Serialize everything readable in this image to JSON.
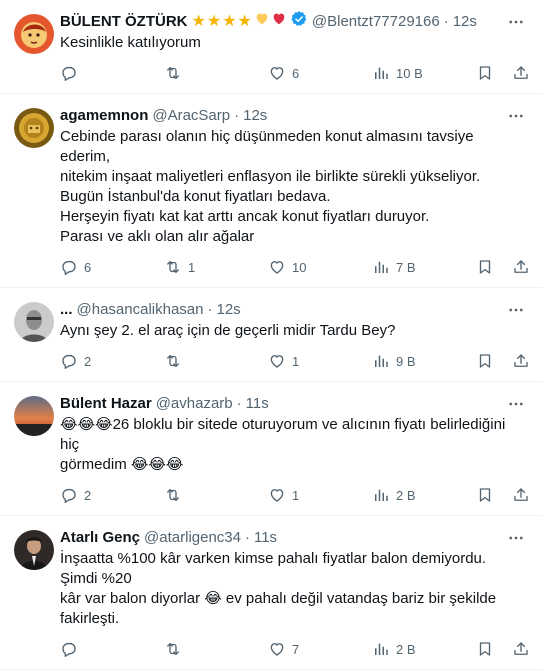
{
  "tweets": [
    {
      "name": "BÜLENT ÖZTÜRK",
      "name_emojis": "★★★★",
      "handle": "@Blentzt77729166",
      "time": "12s",
      "lines": [
        "Kesinlikle katılıyorum"
      ],
      "replies": "",
      "retweets": "",
      "likes": "6",
      "views": "10 B",
      "verified": true
    },
    {
      "name": "agamemnon",
      "handle": "@AracSarp",
      "time": "12s",
      "lines": [
        "Cebinde parası olanın hiç düşünmeden konut almasını tavsiye ederim,",
        "nitekim inşaat maliyetleri enflasyon ile birlikte sürekli yükseliyor.",
        "Bugün İstanbul'da konut fiyatları bedava.",
        "Herşeyin fiyatı kat kat arttı ancak konut fiyatları duruyor.",
        "Parası ve aklı olan alır ağalar"
      ],
      "replies": "6",
      "retweets": "1",
      "likes": "10",
      "views": "7 B"
    },
    {
      "name": "...",
      "handle": "@hasancalikhasan",
      "time": "12s",
      "lines": [
        "Aynı şey 2. el araç için de geçerli midir Tardu Bey?"
      ],
      "replies": "2",
      "retweets": "",
      "likes": "1",
      "views": "9 B"
    },
    {
      "name": "Bülent Hazar",
      "handle": "@avhazarb",
      "time": "11s",
      "lines": [
        "😂😂😂26 bloklu bir sitede oturuyorum ve alıcının fiyatı belirlediğini hiç",
        "görmedim 😂😂😂"
      ],
      "replies": "2",
      "retweets": "",
      "likes": "1",
      "views": "2 B"
    },
    {
      "name": "Atarlı Genç",
      "handle": "@atarligenc34",
      "time": "11s",
      "lines": [
        "İnşaatta %100 kâr varken kimse pahalı fiyatlar balon demiyordu. Şimdi %20",
        "kâr var balon diyorlar 😂 ev pahalı değil vatandaş bariz bir şekilde fakirleşti."
      ],
      "replies": "",
      "retweets": "",
      "likes": "7",
      "views": "2 B"
    }
  ],
  "icons": {
    "reply": "reply-icon",
    "retweet": "retweet-icon",
    "like": "heart-icon",
    "views": "views-icon",
    "bookmark": "bookmark-icon",
    "share": "share-icon",
    "more": "more-icon"
  },
  "colors": {
    "text": "#0f1419",
    "secondary": "#536471",
    "border": "#eff3f4",
    "verified": "#1d9bf0",
    "star": "#f4b400"
  }
}
